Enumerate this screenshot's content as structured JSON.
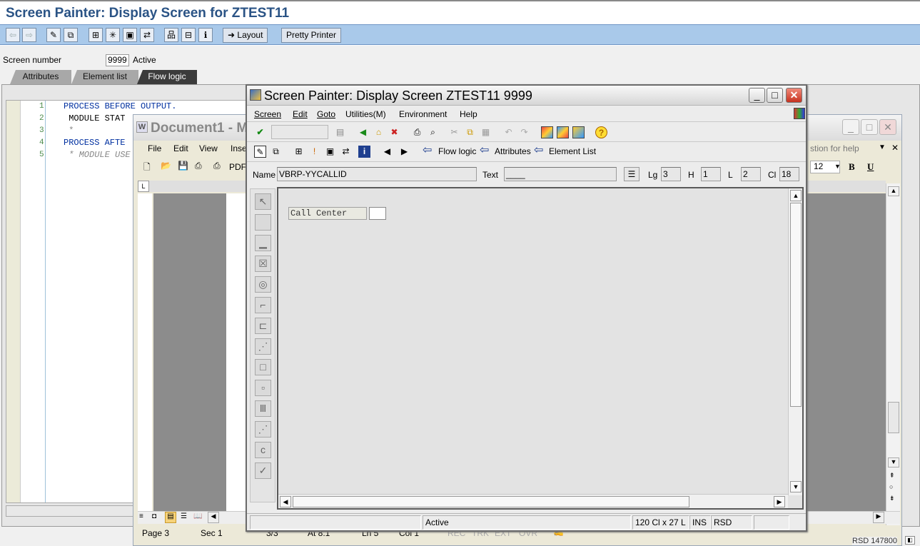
{
  "sap": {
    "title": "Screen Painter: Display Screen for ZTEST11",
    "toolbar": {
      "layout_label": "Layout",
      "pretty_printer_label": "Pretty Printer"
    },
    "screen_number_label": "Screen number",
    "screen_number_value": "9999",
    "screen_status": "Active",
    "tabs": [
      "Attributes",
      "Element list",
      "Flow logic"
    ],
    "active_tab": "Flow logic",
    "code_lines": [
      {
        "num": "1",
        "text": "PROCESS BEFORE OUTPUT."
      },
      {
        "num": "2",
        "text": " MODULE STAT"
      },
      {
        "num": "3",
        "text": " *"
      },
      {
        "num": "4",
        "text": "PROCESS AFTE"
      },
      {
        "num": "5",
        "text": " * MODULE USE"
      }
    ]
  },
  "word": {
    "title": "Document1 - M",
    "menu": [
      "File",
      "Edit",
      "View",
      "Inse"
    ],
    "help_hint": "stion for help",
    "font_size": "12",
    "pdf_label": "PDF",
    "status": {
      "page": "Page 3",
      "sec": "Sec 1",
      "pages": "3/3",
      "at": "At 8.1",
      "ln": "Ln 5",
      "col": "Col 1",
      "rec": "REC",
      "trk": "TRK",
      "ext": "EXT",
      "ovr": "OVR"
    },
    "bottom_right": "RSD 147800"
  },
  "popup": {
    "title": "Screen Painter:  Display Screen ZTEST11 9999",
    "menu": [
      "Screen",
      "Edit",
      "Goto",
      "Utilities(M)",
      "Environment",
      "Help"
    ],
    "nav": {
      "flow_logic": "Flow logic",
      "attributes": "Attributes",
      "element_list": "Element List"
    },
    "fields": {
      "name_label": "Name",
      "name_value": "VBRP-YYCALLID",
      "text_label": "Text",
      "text_value": "____",
      "lg_label": "Lg",
      "lg_value": "3",
      "h_label": "H",
      "h_value": "1",
      "l_label": "L",
      "l_value": "2",
      "cl_label": "Cl",
      "cl_value": "18"
    },
    "canvas": {
      "text_label": "Call Center"
    },
    "status": {
      "state": "Active",
      "size": "120 Cl x 27 L",
      "mode": "INS",
      "system": "RSD"
    }
  }
}
